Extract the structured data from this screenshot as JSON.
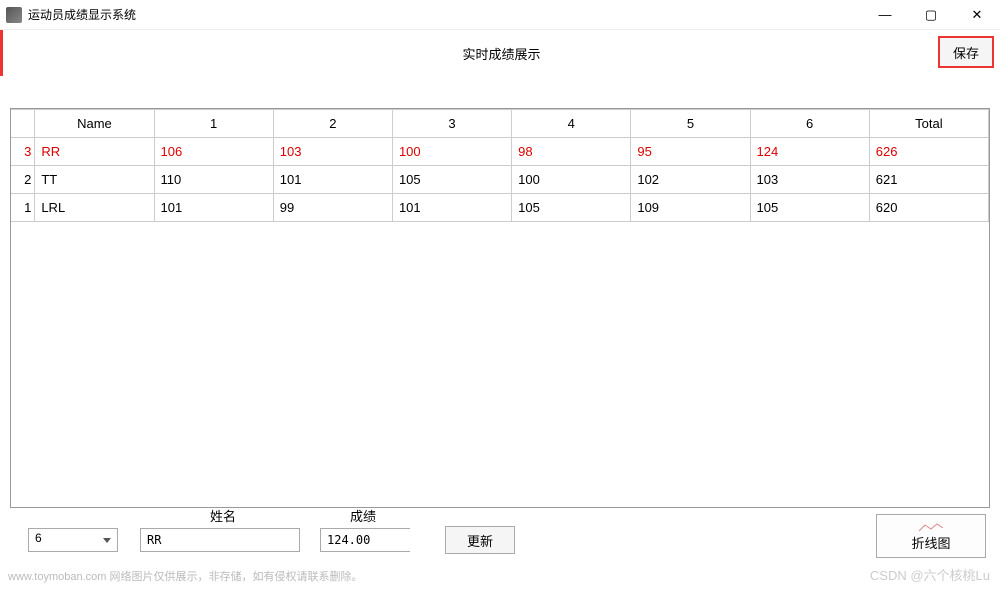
{
  "window": {
    "title": "运动员成绩显示系统"
  },
  "header": {
    "subtitle": "实时成绩展示",
    "save_label": "保存"
  },
  "table": {
    "columns": [
      "Name",
      "1",
      "2",
      "3",
      "4",
      "5",
      "6",
      "Total"
    ],
    "rows": [
      {
        "num": "3",
        "highlight": true,
        "cells": [
          "RR",
          "106",
          "103",
          "100",
          "98",
          "95",
          "124",
          "626"
        ]
      },
      {
        "num": "2",
        "highlight": false,
        "cells": [
          "TT",
          "110",
          "101",
          "105",
          "100",
          "102",
          "103",
          "621"
        ]
      },
      {
        "num": "1",
        "highlight": false,
        "cells": [
          "LRL",
          "101",
          "99",
          "101",
          "105",
          "109",
          "105",
          "620"
        ]
      }
    ]
  },
  "form": {
    "name_label": "姓名",
    "score_label": "成绩",
    "combo_value": "6",
    "name_value": "RR",
    "score_value": "124.00",
    "update_label": "更新",
    "chart_label": "折线图"
  },
  "watermark": {
    "left": "www.toymoban.com 网络图片仅供展示，非存储，如有侵权请联系删除。",
    "right": "CSDN @六个核桃Lu"
  }
}
